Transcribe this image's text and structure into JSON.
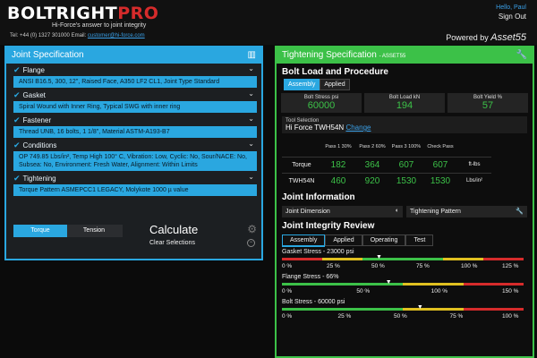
{
  "header": {
    "logo_part1": "BOLTRIGHT",
    "logo_part2": "PRO",
    "tagline": "Hi-Force's answer to joint integrity",
    "phone": "Tel: +44 (0) 1327 301000",
    "email_label": "Email:",
    "email": "customer@hi-force.com",
    "hello": "Hello, Paul",
    "signout": "Sign Out",
    "powered_by": "Powered by",
    "powered_brand": "Asset55"
  },
  "joint_spec": {
    "title": "Joint Specification",
    "sections": [
      {
        "label": "Flange",
        "body": "ANSI B16.5, 300, 12\", Raised Face, A350 LF2 CL1, Joint Type Standard"
      },
      {
        "label": "Gasket",
        "body": "Spiral Wound with Inner Ring, Typical SWG with inner ring"
      },
      {
        "label": "Fastener",
        "body": "Thread UNB, 16 bolts, 1 1/8\", Material ASTM-A193-B7"
      },
      {
        "label": "Conditions",
        "body": "OP 749.85 Lbs/in², Temp High 100° C, Vibration: Low, Cyclic: No, Sour/NACE: No, Subsea: No, Environment: Fresh Water, Alignment: Within Limits"
      },
      {
        "label": "Tightening",
        "body": "Torque Pattern ASMEPCC1 LEGACY, Molykote 1000 µ value"
      }
    ],
    "toggle_torque": "Torque",
    "toggle_tension": "Tension",
    "calculate": "Calculate",
    "clear": "Clear Selections"
  },
  "tightening": {
    "title": "Tightening Specification",
    "subtitle": "- ASSET55",
    "bolt_load_title": "Bolt Load and Procedure",
    "tabs": [
      "Assembly",
      "Applied"
    ],
    "kpis": [
      {
        "label": "Bolt Stress psi",
        "value": "60000"
      },
      {
        "label": "Bolt Load kN",
        "value": "194"
      },
      {
        "label": "Bolt Yield %",
        "value": "57"
      }
    ],
    "tool_label": "Tool Selection",
    "tool_value": "Hi Force TWH54N",
    "tool_change": "Change",
    "table_headers": [
      "Pass 1 30%",
      "Pass 2 60%",
      "Pass 3 100%",
      "Check Pass"
    ],
    "rows": [
      {
        "label": "Torque",
        "values": [
          "182",
          "364",
          "607",
          "607"
        ],
        "unit": "ft-lbs"
      },
      {
        "label": "TWH54N",
        "values": [
          "460",
          "920",
          "1530",
          "1530"
        ],
        "unit": "Lbs/in²"
      }
    ],
    "joint_info_title": "Joint Information",
    "joint_dimension": "Joint Dimension",
    "tightening_pattern": "Tightening Pattern",
    "review_title": "Joint Integrity Review",
    "review_tabs": [
      "Assembly",
      "Applied",
      "Operating",
      "Test"
    ],
    "gauges": [
      {
        "label": "Gasket Stress - 23000 psi",
        "ticks": [
          "0 %",
          "25 %",
          "50 %",
          "75 %",
          "100 %",
          "125 %"
        ],
        "marker_fraction": 0.4,
        "segments": [
          "#d62b2b",
          "#e0c020",
          "#3cc148",
          "#3cc148",
          "#e0c020",
          "#d62b2b"
        ]
      },
      {
        "label": "Flange Stress - 66%",
        "ticks": [
          "0 %",
          "50 %",
          "100 %",
          "150 %"
        ],
        "marker_fraction": 0.44,
        "segments": [
          "#3cc148",
          "#3cc148",
          "#e0c020",
          "#d62b2b"
        ]
      },
      {
        "label": "Bolt Stress - 60000 psi",
        "ticks": [
          "0 %",
          "25 %",
          "50 %",
          "75 %",
          "100 %"
        ],
        "marker_fraction": 0.57,
        "segments": [
          "#3cc148",
          "#3cc148",
          "#e0c020",
          "#d62b2b"
        ]
      }
    ]
  }
}
